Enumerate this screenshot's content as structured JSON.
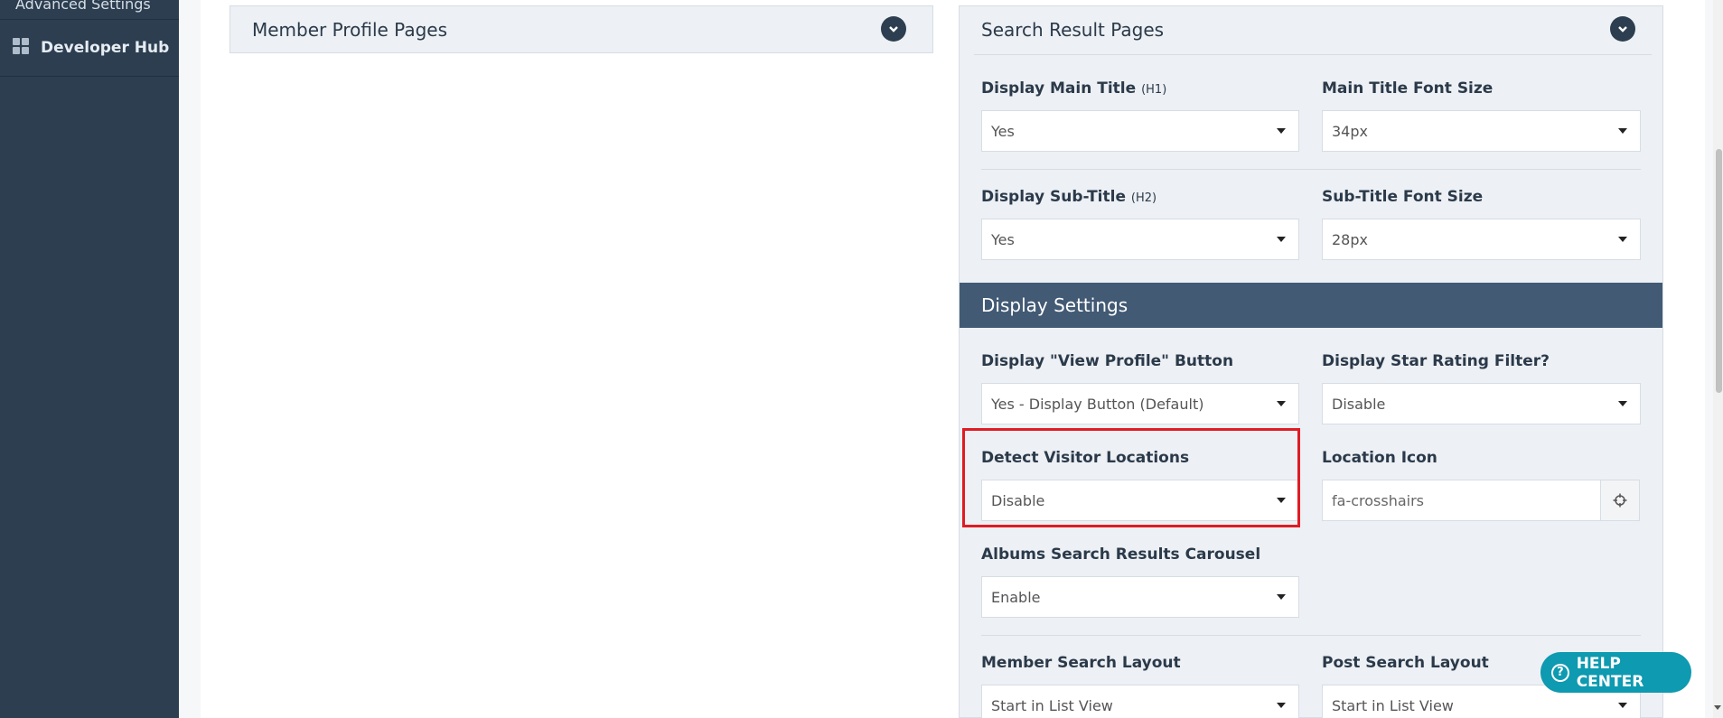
{
  "sidebar": {
    "items": [
      {
        "label": "Advanced Settings"
      },
      {
        "label": "Developer Hub",
        "icon": "grid-icon"
      }
    ]
  },
  "member_profile_panel": {
    "title": "Member Profile Pages"
  },
  "search_result_panel": {
    "title": "Search Result Pages",
    "fields": {
      "display_main_title": {
        "label": "Display Main Title",
        "tag": "(H1)",
        "value": "Yes"
      },
      "main_title_font_size": {
        "label": "Main Title Font Size",
        "value": "34px"
      },
      "display_sub_title": {
        "label": "Display Sub-Title",
        "tag": "(H2)",
        "value": "Yes"
      },
      "sub_title_font_size": {
        "label": "Sub-Title Font Size",
        "value": "28px"
      }
    }
  },
  "display_settings": {
    "title": "Display Settings",
    "fields": {
      "view_profile_button": {
        "label": "Display \"View Profile\" Button",
        "value": "Yes - Display Button (Default)"
      },
      "star_rating_filter": {
        "label": "Display Star Rating Filter?",
        "value": "Disable"
      },
      "detect_visitor_locations": {
        "label": "Detect Visitor Locations",
        "value": "Disable"
      },
      "location_icon": {
        "label": "Location Icon",
        "value": "fa-crosshairs",
        "icon": "crosshairs-icon"
      },
      "albums_carousel": {
        "label": "Albums Search Results Carousel",
        "value": "Enable"
      },
      "member_search_layout": {
        "label": "Member Search Layout",
        "value": "Start in List View"
      },
      "post_search_layout": {
        "label": "Post Search Layout",
        "value": "Start in List View"
      }
    }
  },
  "help_center": {
    "label": "HELP CENTER"
  },
  "colors": {
    "sidebar_bg": "#2c3e50",
    "section_bar": "#425a74",
    "help_button": "#0e9ab0",
    "highlight": "#e01b24"
  }
}
